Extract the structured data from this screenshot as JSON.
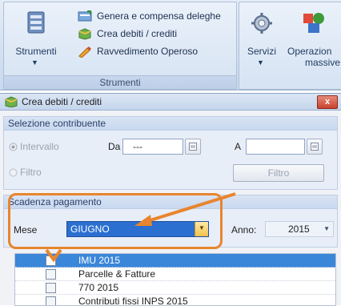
{
  "ribbon": {
    "strumenti_label": "Strumenti",
    "menu_items": [
      "Genera e compensa deleghe",
      "Crea debiti / crediti",
      "Ravvedimento Operoso"
    ],
    "group_title": "Strumenti",
    "servizi_label": "Servizi",
    "operazioni_label_1": "Operazion",
    "operazioni_label_2": "massive"
  },
  "dialog": {
    "title": "Crea debiti / crediti",
    "close_label": "x",
    "selezione": {
      "header": "Selezione contribuente",
      "radio_intervallo": "Intervallo",
      "radio_filtro": "Filtro",
      "da_label": "Da",
      "da_value": "---",
      "a_label": "A",
      "filtro_button": "Filtro"
    },
    "scadenza": {
      "header": "Scadenza pagamento",
      "mese_label": "Mese",
      "mese_value": "GIUGNO",
      "anno_label": "Anno:",
      "anno_value": "2015"
    },
    "items": [
      {
        "label": "IMU 2015",
        "checked": true,
        "selected": true
      },
      {
        "label": "Parcelle & Fatture",
        "checked": false,
        "selected": false
      },
      {
        "label": "770 2015",
        "checked": false,
        "selected": false
      },
      {
        "label": "Contributi fissi INPS 2015",
        "checked": false,
        "selected": false
      }
    ]
  },
  "colors": {
    "accent": "#e8852e",
    "selection": "#3a86d9"
  }
}
